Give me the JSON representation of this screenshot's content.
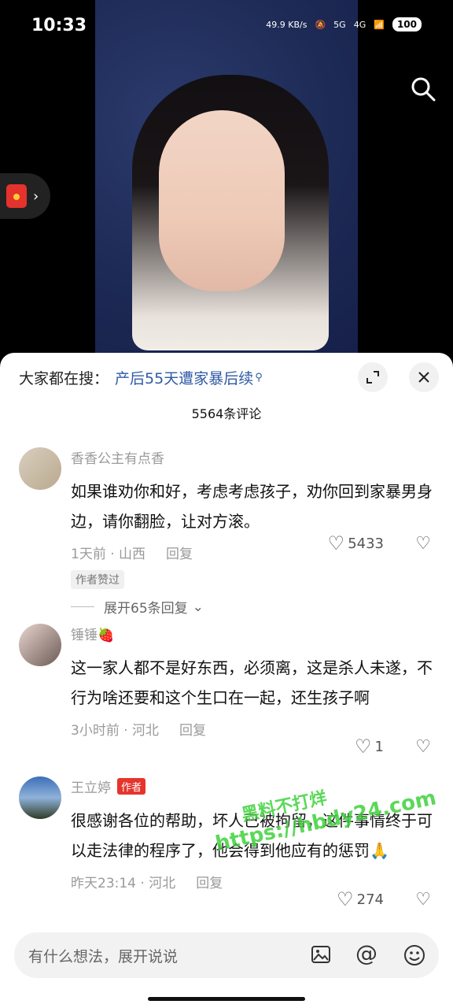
{
  "status_bar": {
    "time": "10:33",
    "net_speed": "49.9 KB/s",
    "signal_5g": "5G",
    "signal_4g": "4G",
    "battery": "100"
  },
  "sheet": {
    "hot_search_prefix": "大家都在搜：",
    "hot_search_query": "产后55天遭家暴后续",
    "comment_count": "5564条评论"
  },
  "comments": [
    {
      "name": "香香公主有点香",
      "text": "如果谁劝你和好，考虑考虑孩子，劝你回到家暴男身边，请你翻脸，让对方滚。",
      "time_location": "1天前 · 山西",
      "reply": "回复",
      "likes": "5433",
      "author_liked": "作者赞过",
      "expand_replies": "展开65条回复"
    },
    {
      "name": "锤锤🍓",
      "text": "这一家人都不是好东西，必须离，这是杀人未遂，不行为啥还要和这个生口在一起，还生孩子啊",
      "time_location": "3小时前 · 河北",
      "reply": "回复",
      "likes": "1"
    },
    {
      "name": "王立婷",
      "author_tag": "作者",
      "text": "很感谢各位的帮助，坏人已被拘留，这件事情终于可以走法律的程序了，他会得到他应有的惩罚🙏",
      "time_location": "昨天23:14 · 河北",
      "reply": "回复",
      "likes": "274"
    }
  ],
  "input": {
    "placeholder": "有什么想法，展开说说"
  },
  "watermark": {
    "line1": "黑料不打烊",
    "line2": "https://hbdy24.com"
  },
  "colors": {
    "accent_link": "#2e5aa5",
    "author_tag": "#e5352c",
    "watermark": "#3fd23b"
  }
}
